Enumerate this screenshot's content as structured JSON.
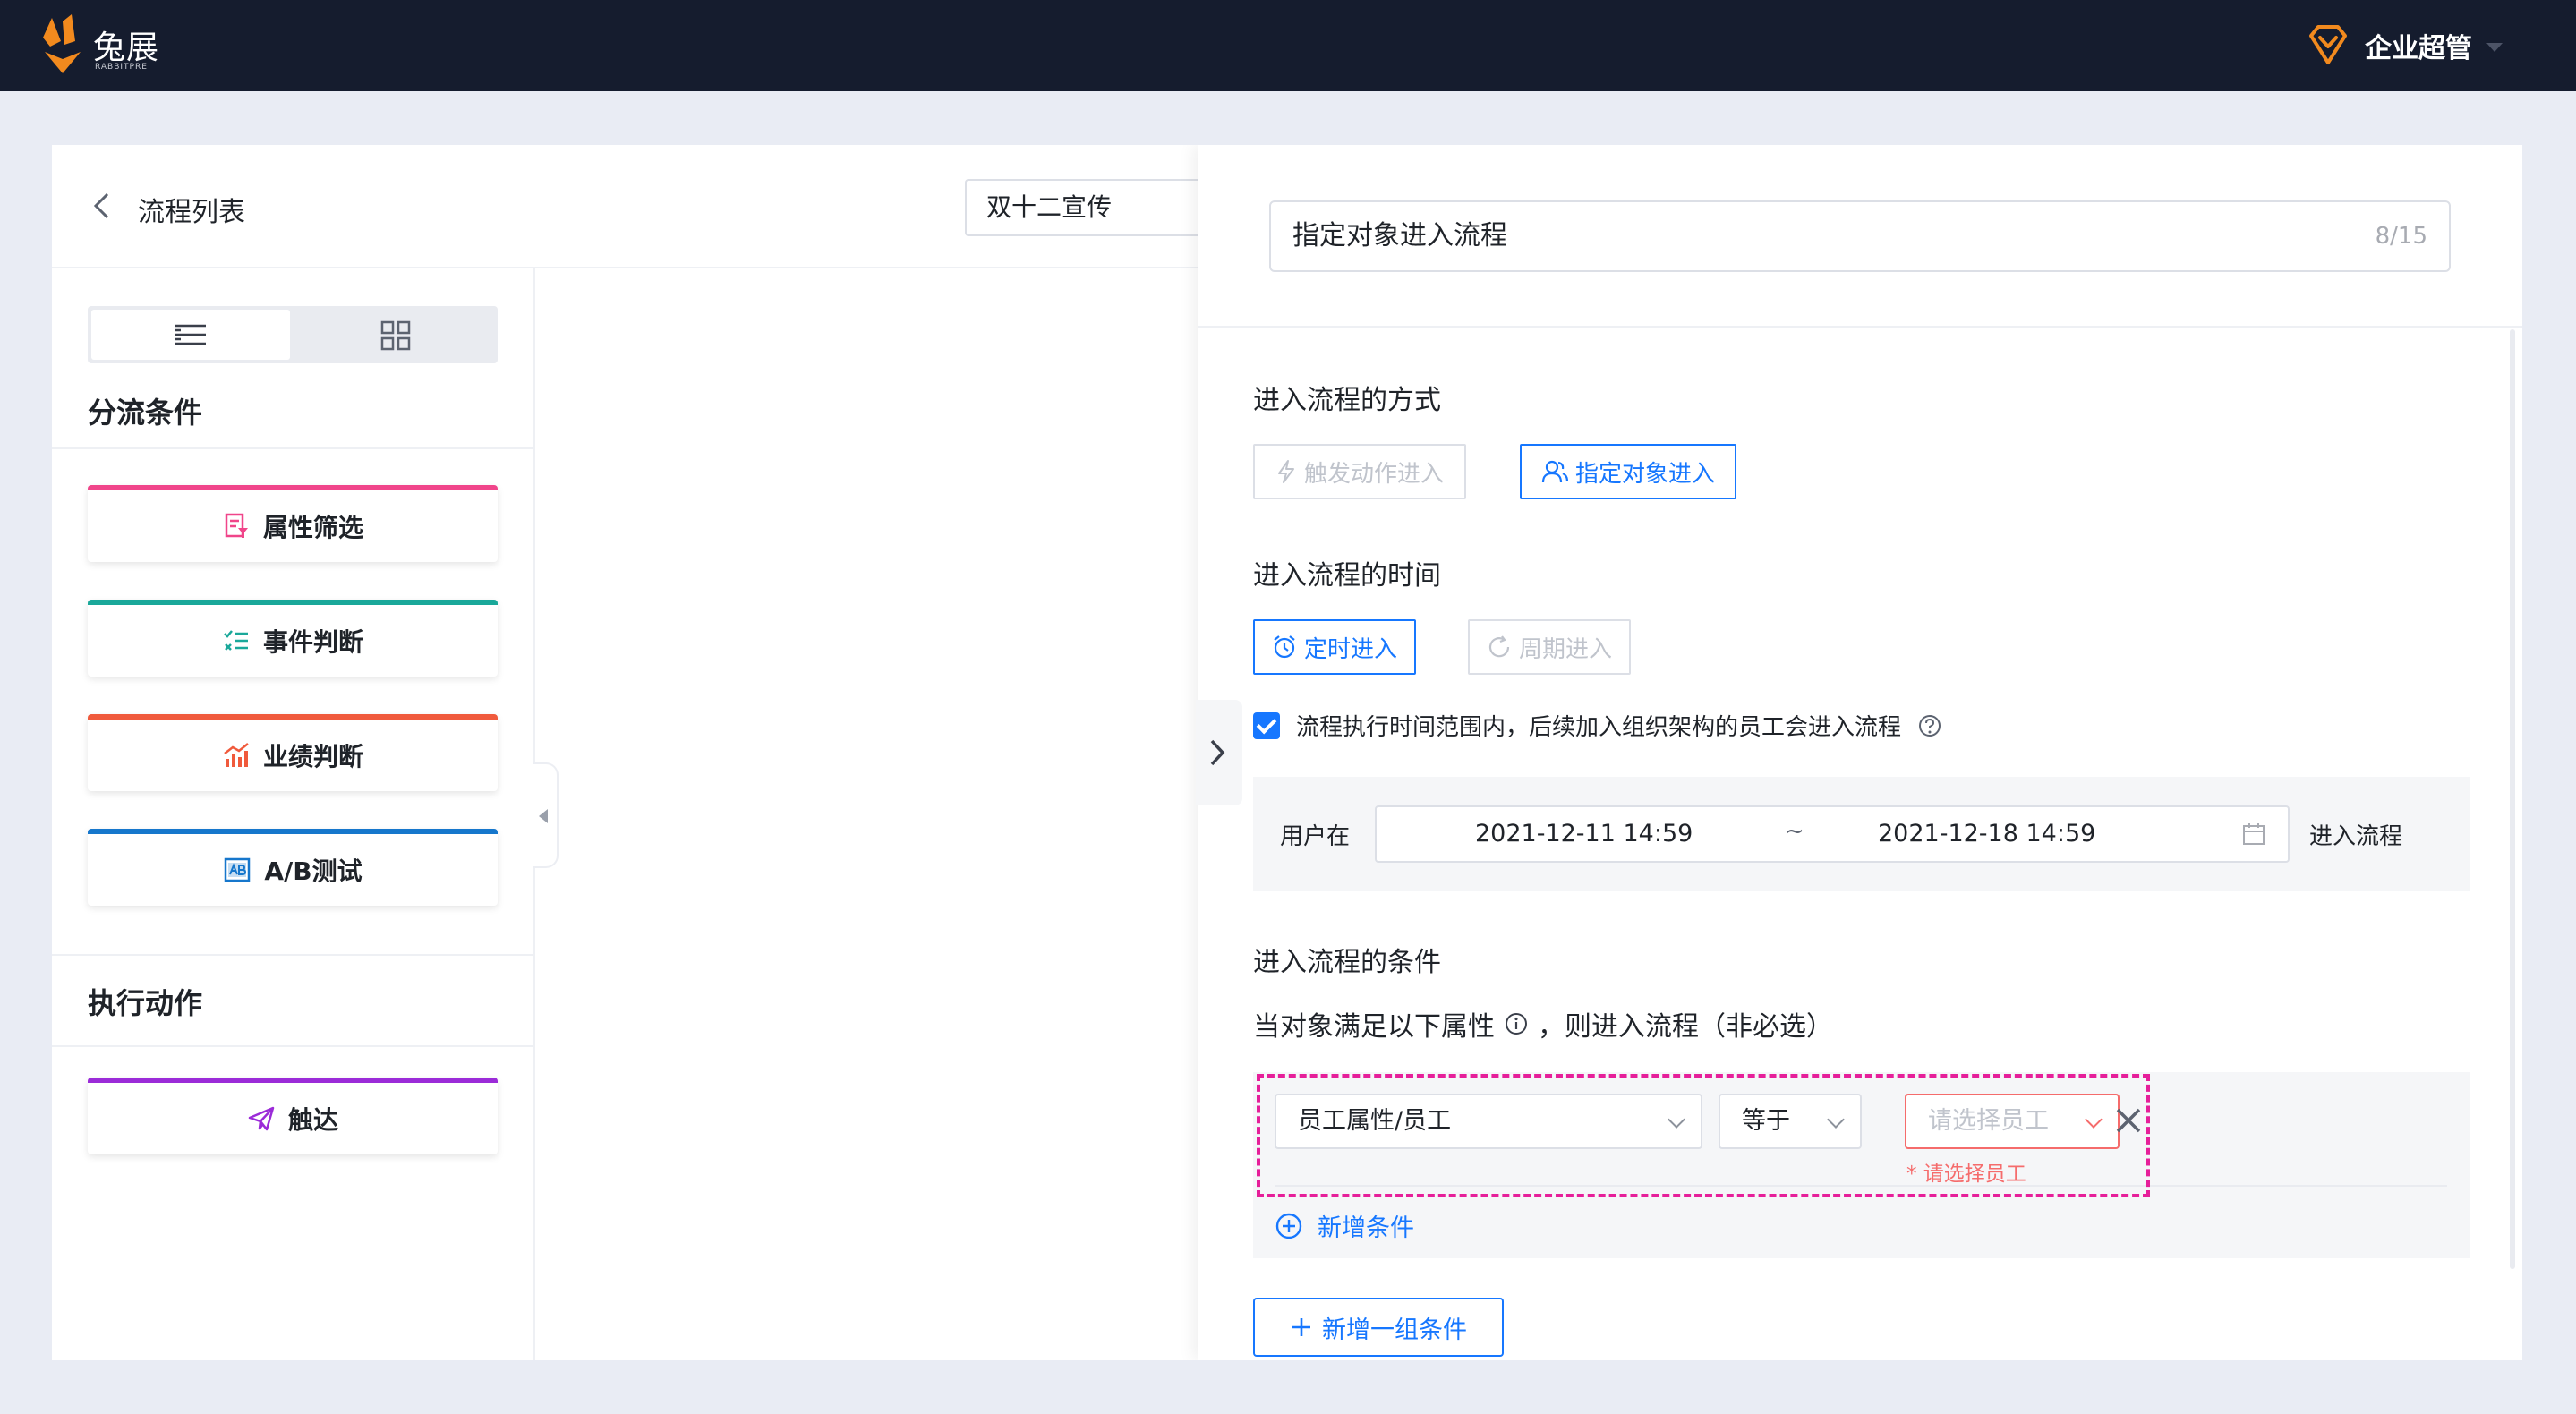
{
  "topbar": {
    "logo_cn": "兔展",
    "logo_en": "RABBITPRE",
    "user_name": "企业超管"
  },
  "header": {
    "back_icon": "chevron-left-icon",
    "list_title": "流程列表",
    "flow_name": "双十二宣传"
  },
  "leftpanel": {
    "view_toggle": [
      "list-view-icon",
      "grid-view-icon"
    ],
    "branch_title": "分流条件",
    "branch_cards": [
      {
        "label": "属性筛选",
        "icon": "filter-icon",
        "color": "#f0458a"
      },
      {
        "label": "事件判断",
        "icon": "event-check-icon",
        "color": "#1aa89a"
      },
      {
        "label": "业绩判断",
        "icon": "performance-chart-icon",
        "color": "#f05a3c"
      },
      {
        "label": "A/B测试",
        "icon": "ab-test-icon",
        "color": "#1677cc"
      }
    ],
    "action_title": "执行动作",
    "action_cards": [
      {
        "label": "触达",
        "icon": "send-icon",
        "color": "#9b2bd8"
      }
    ]
  },
  "drawer": {
    "node_name": "指定对象进入流程",
    "node_name_count": "8/15",
    "entry_mode": {
      "title": "进入流程的方式",
      "options": [
        {
          "label": "触发动作进入",
          "icon": "lightning-icon",
          "active": false
        },
        {
          "label": "指定对象进入",
          "icon": "users-icon",
          "active": true
        }
      ]
    },
    "entry_time": {
      "title": "进入流程的时间",
      "options": [
        {
          "label": "定时进入",
          "icon": "alarm-clock-icon",
          "active": true
        },
        {
          "label": "周期进入",
          "icon": "cycle-icon",
          "active": false
        }
      ],
      "checkbox_label": "流程执行时间范围内，后续加入组织架构的员工会进入流程",
      "range_prefix": "用户在",
      "range_start": "2021-12-11 14:59",
      "range_separator": "~",
      "range_end": "2021-12-18 14:59",
      "range_suffix": "进入流程"
    },
    "conditions": {
      "title": "进入流程的条件",
      "subtitle": "当对象满足以下属性",
      "subtitle_suffix": "，则进入流程（非必选）",
      "field": "员工属性/员工",
      "operator": "等于",
      "value_placeholder": "请选择员工",
      "error": "* 请选择员工",
      "add_condition": "新增条件",
      "add_group": "新增一组条件"
    }
  },
  "colors": {
    "topbar": "#151c2e",
    "primary": "#1677ff",
    "logo_orange": "#f28a1e",
    "highlight": "#e61f9a",
    "error": "#f56c6c"
  }
}
